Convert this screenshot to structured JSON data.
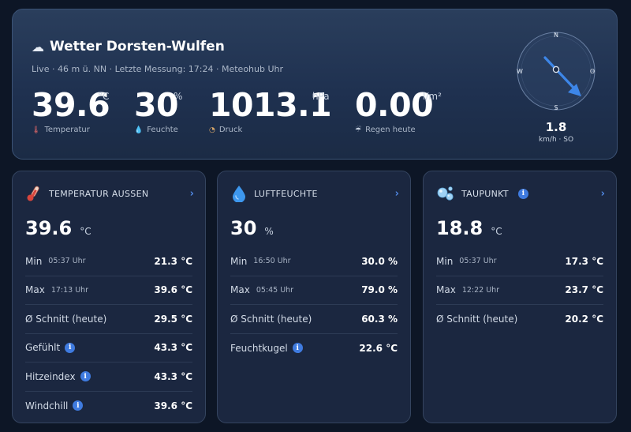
{
  "hero": {
    "icon": "cloud-icon",
    "title": "Wetter Dorsten-Wulfen",
    "subtitle": "Live · 46 m ü. NN · Letzte Messung: 17:24 · Meteohub Uhr",
    "metrics": [
      {
        "value": "39.6",
        "unit": "°C",
        "label": "Temperatur",
        "icon": "thermometer-icon"
      },
      {
        "value": "30",
        "unit": "%",
        "label": "Feuchte",
        "icon": "droplet-icon"
      },
      {
        "value": "1013.1",
        "unit": "hPa",
        "label": "Druck",
        "icon": "gauge-icon"
      },
      {
        "value": "0.00",
        "unit": "l/m²",
        "label": "Regen heute",
        "icon": "rain-cloud-icon"
      }
    ],
    "compass": {
      "n": "N",
      "o": "O",
      "s": "S",
      "w": "W",
      "direction_deg": 135
    },
    "wind": {
      "value": "1.8",
      "unit": "km/h · SO"
    }
  },
  "cards": [
    {
      "title": "TEMPERATUR AUSSEN",
      "icon": "thermometer-icon",
      "value": "39.6",
      "unit": "°C",
      "rows": [
        {
          "label": "Min",
          "time": "05:37 Uhr",
          "value": "21.3 °C"
        },
        {
          "label": "Max",
          "time": "17:13 Uhr",
          "value": "39.6 °C"
        },
        {
          "label": "Ø Schnitt (heute)",
          "time": "",
          "value": "29.5 °C"
        },
        {
          "label": "Gefühlt",
          "time": "",
          "value": "43.3 °C",
          "info": true
        },
        {
          "label": "Hitzeindex",
          "time": "",
          "value": "43.3 °C",
          "info": true
        },
        {
          "label": "Windchill",
          "time": "",
          "value": "39.6 °C",
          "info": true
        }
      ]
    },
    {
      "title": "LUFTFEUCHTE",
      "icon": "droplet-icon",
      "value": "30",
      "unit": "%",
      "rows": [
        {
          "label": "Min",
          "time": "16:50 Uhr",
          "value": "30.0 %"
        },
        {
          "label": "Max",
          "time": "05:45 Uhr",
          "value": "79.0 %"
        },
        {
          "label": "Ø Schnitt (heute)",
          "time": "",
          "value": "60.3 %"
        },
        {
          "label": "Feuchtkugel",
          "time": "",
          "value": "22.6 °C",
          "info": true
        }
      ]
    },
    {
      "title": "TAUPUNKT",
      "icon": "dew-bubbles-icon",
      "value": "18.8",
      "unit": "°C",
      "rows": [
        {
          "label": "Min",
          "time": "05:37 Uhr",
          "value": "17.3 °C"
        },
        {
          "label": "Max",
          "time": "12:22 Uhr",
          "value": "23.7 °C"
        },
        {
          "label": "Ø Schnitt (heute)",
          "time": "",
          "value": "20.2 °C"
        }
      ]
    }
  ],
  "colors": {
    "accent": "#3f7be0",
    "arrow": "#3d86e8",
    "background": "#0d1626"
  }
}
